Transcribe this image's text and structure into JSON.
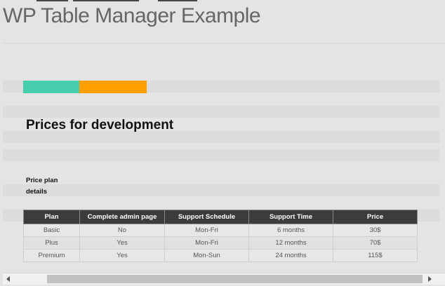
{
  "page": {
    "title": "WP Table Manager Example"
  },
  "colors": {
    "tab_primary": "#47cfad",
    "tab_secondary": "#ff9f00",
    "table_header_bg": "#3c3c3c"
  },
  "section": {
    "heading": "Prices for development"
  },
  "plan_details_label": "Price plan details",
  "table": {
    "headers": [
      "Plan",
      "Complete admin page",
      "Support Schedule",
      "Support Time",
      "Price"
    ],
    "rows": [
      [
        "Basic",
        "No",
        "Mon-Fri",
        "6 months",
        "30$"
      ],
      [
        "Plus",
        "Yes",
        "Mon-Fri",
        "12 months",
        "70$"
      ],
      [
        "Premium",
        "Yes",
        "Mon-Sun",
        "24 months",
        "115$"
      ]
    ]
  },
  "scrollbar": {
    "left_arrow_icon": "triangle-left",
    "right_arrow_icon": "triangle-right"
  }
}
